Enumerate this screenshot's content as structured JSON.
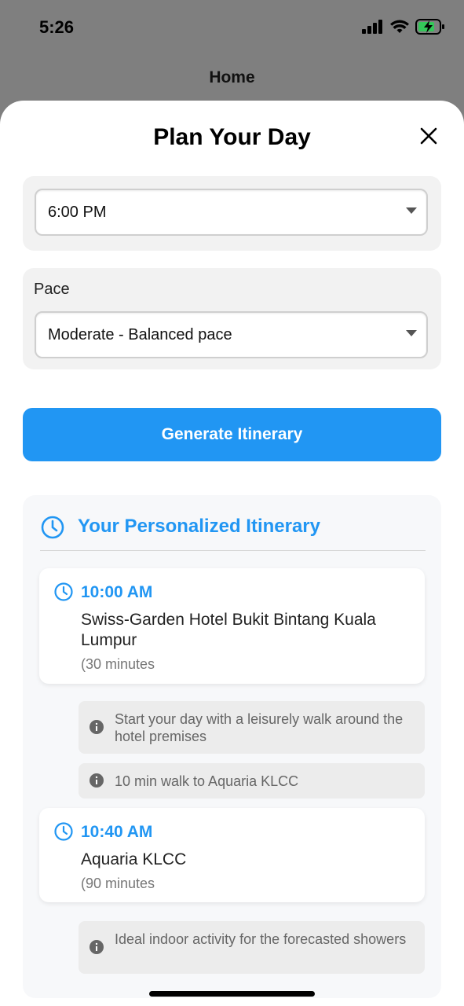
{
  "status": {
    "time": "5:26"
  },
  "behind": {
    "title": "Home"
  },
  "sheet": {
    "title": "Plan Your Day",
    "end_time": {
      "value": "6:00 PM"
    },
    "pace": {
      "label": "Pace",
      "value": "Moderate - Balanced pace"
    },
    "generate_label": "Generate Itinerary"
  },
  "itinerary": {
    "heading": "Your Personalized Itinerary",
    "stops": [
      {
        "time": "10:00 AM",
        "name": "Swiss-Garden Hotel Bukit Bintang Kuala Lumpur",
        "duration": "(30 minutes"
      },
      {
        "time": "10:40 AM",
        "name": "Aquaria KLCC",
        "duration": "(90 minutes"
      }
    ],
    "notes": [
      "Start your day with a leisurely walk around the hotel premises",
      "10 min walk to Aquaria KLCC",
      "Ideal indoor activity for the forecasted showers"
    ]
  },
  "colors": {
    "accent": "#2196f3",
    "note_bg": "#ececec",
    "card_bg": "#f2f2f2"
  }
}
